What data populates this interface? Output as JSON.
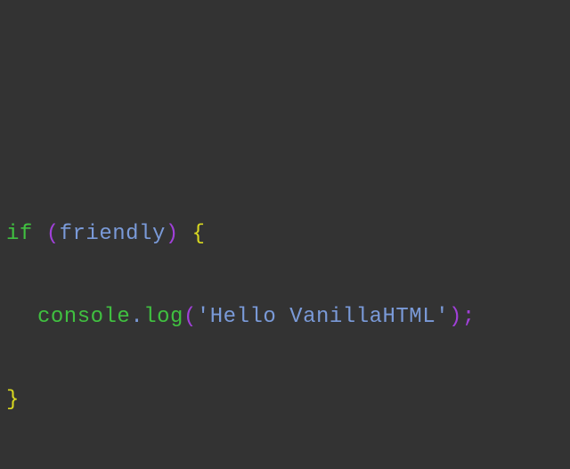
{
  "colors": {
    "background": "#333333",
    "keyword": "#40c040",
    "paren": "#a040d8",
    "identifier": "#7a9ad8",
    "brace": "#d8d820",
    "method": "#40c040",
    "string": "#7a9ad8",
    "punctuation": "#7a9ad8",
    "semicolon": "#a040d8"
  },
  "code": {
    "line1": {
      "keyword": "if",
      "space1": " ",
      "open_paren": "(",
      "condition": "friendly",
      "close_paren": ")",
      "space2": " ",
      "open_brace": "{"
    },
    "line2": {
      "object": "console",
      "dot": ".",
      "method": "log",
      "open_paren": "(",
      "string": "'Hello VanillaHTML'",
      "close_paren": ")",
      "semicolon": ";"
    },
    "line3": {
      "close_brace": "}"
    }
  }
}
